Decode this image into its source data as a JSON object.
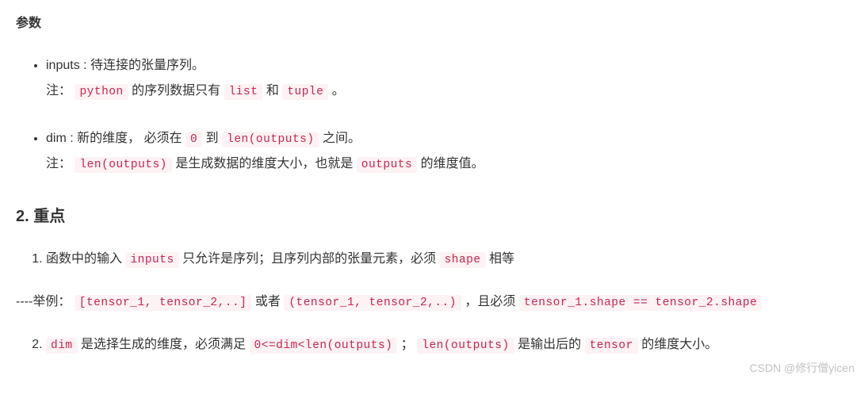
{
  "headings": {
    "params": "参数",
    "keypoints": "2. 重点"
  },
  "params": {
    "inputs": {
      "name": "inputs",
      "desc_after": " : 待连接的张量序列。",
      "note_label": "注：",
      "code_python": "python",
      "note_mid1": " 的序列数据只有 ",
      "code_list": "list",
      "note_mid2": " 和 ",
      "code_tuple": "tuple",
      "note_end": " 。"
    },
    "dim": {
      "name": "dim",
      "desc_before": " : 新的维度， 必须在 ",
      "code_zero": "0",
      "desc_mid": " 到 ",
      "code_len": "len(outputs)",
      "desc_after": " 之间。",
      "note_label": "注：",
      "note_code_len": "len(outputs)",
      "note_mid1": " 是生成数据的维度大小，也就是 ",
      "note_code_outputs": "outputs",
      "note_end": " 的维度值。"
    }
  },
  "keypoints": {
    "item1": {
      "pre": "函数中的输入 ",
      "code_inputs": "inputs",
      "mid": " 只允许是序列；且序列内部的张量元素，必须 ",
      "code_shape": "shape",
      "post": " 相等"
    },
    "example": {
      "prefix": "----举例：",
      "code_list": "[tensor_1, tensor_2,..]",
      "mid1": " 或者 ",
      "code_tuple": "(tensor_1, tensor_2,..)",
      "mid2": " ，且必须 ",
      "code_eq": "tensor_1.shape == tensor_2.shape"
    },
    "item2": {
      "code_dim": "dim",
      "t1": " 是选择生成的维度，必须满足 ",
      "code_range": "0<=dim<len(outputs)",
      "t2": " ； ",
      "code_len": "len(outputs)",
      "t3": " 是输出后的 ",
      "code_tensor": "tensor",
      "t4": " 的维度大小。"
    }
  },
  "watermark": "CSDN @修行僧yicen"
}
